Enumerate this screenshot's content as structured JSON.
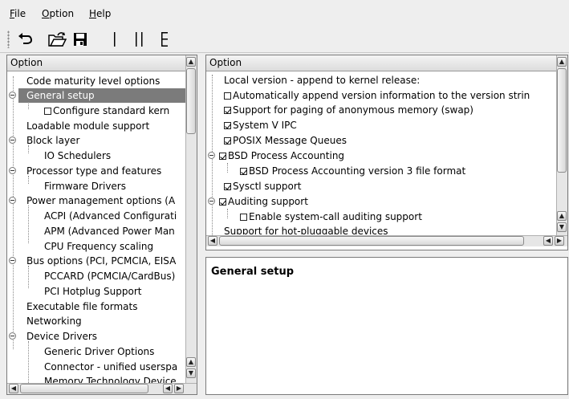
{
  "menu": {
    "file": {
      "hot": "F",
      "rest": "ile"
    },
    "option": {
      "hot": "O",
      "rest": "ption"
    },
    "help": {
      "hot": "H",
      "rest": "elp"
    }
  },
  "toolbar": [
    "undo-icon",
    "open-folder-icon",
    "save-icon",
    "single-view-icon",
    "split-view-icon",
    "full-view-icon"
  ],
  "left_pane": {
    "header": "Option",
    "items": [
      "Code maturity level options",
      "General setup",
      "Configure standard kern",
      "Loadable module support",
      "Block layer",
      "IO Schedulers",
      "Processor type and features",
      "Firmware Drivers",
      "Power management options (A",
      "ACPI (Advanced Configurati",
      "APM (Advanced Power Man",
      "CPU Frequency scaling",
      "Bus options (PCI, PCMCIA, EISA",
      "PCCARD (PCMCIA/CardBus)",
      "PCI Hotplug Support",
      "Executable file formats",
      "Networking",
      "Device Drivers",
      "Generic Driver Options",
      "Connector - unified userspa",
      "Memory Technology Device"
    ],
    "selected_index": 1
  },
  "right_pane": {
    "header": "Option",
    "items": [
      {
        "label": "Local version - append to kernel release:",
        "checkbox": null
      },
      {
        "label": "Automatically append version information to the version strin",
        "checkbox": false
      },
      {
        "label": "Support for paging of anonymous memory (swap)",
        "checkbox": true
      },
      {
        "label": "System V IPC",
        "checkbox": true
      },
      {
        "label": "POSIX Message Queues",
        "checkbox": true
      },
      {
        "label": "BSD Process Accounting",
        "checkbox": true
      },
      {
        "label": "BSD Process Accounting version 3 file format",
        "checkbox": true
      },
      {
        "label": "Sysctl support",
        "checkbox": true
      },
      {
        "label": "Auditing support",
        "checkbox": true
      },
      {
        "label": "Enable system-call auditing support",
        "checkbox": false
      },
      {
        "label": "Support for hot-pluggable devices",
        "checkbox": null
      }
    ]
  },
  "description": {
    "title": "General setup"
  }
}
